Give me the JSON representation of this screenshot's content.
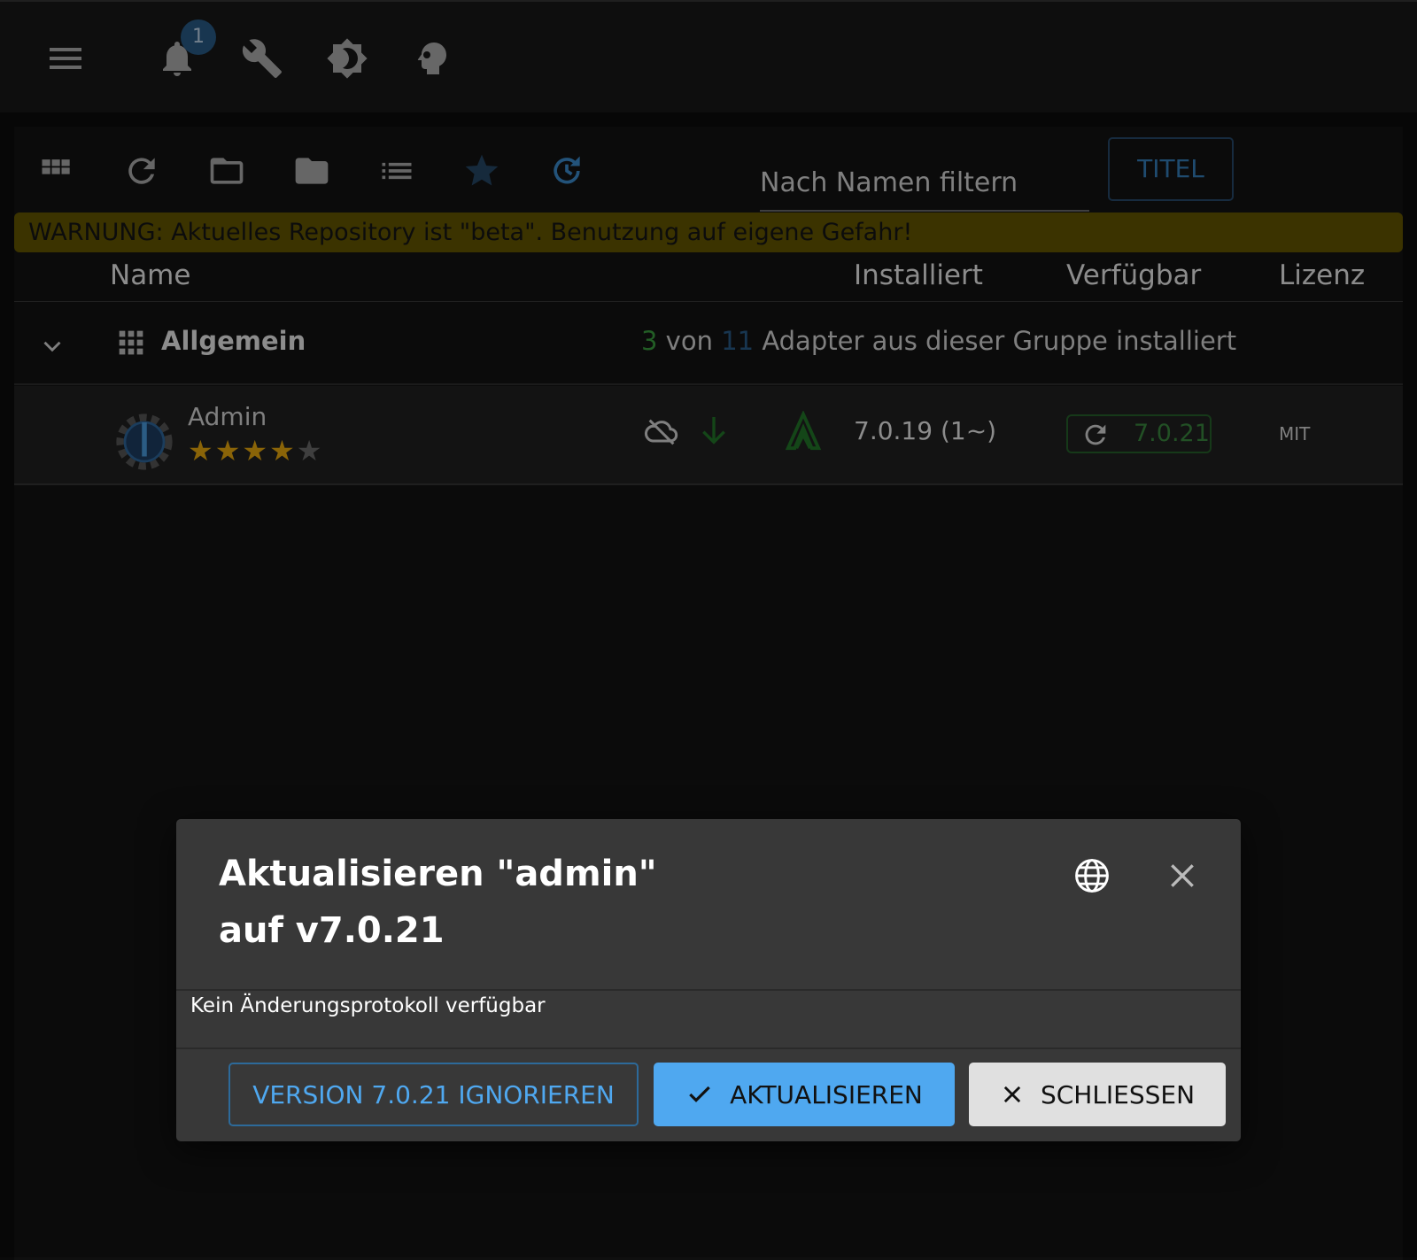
{
  "topbar": {
    "notification_count": "1"
  },
  "toolbar": {
    "filter_placeholder": "Nach Namen filtern",
    "title_button": "TITEL"
  },
  "warning": "WARNUNG: Aktuelles Repository ist \"beta\". Benutzung auf eigene Gefahr!",
  "table": {
    "headers": {
      "name": "Name",
      "installed": "Installiert",
      "available": "Verfügbar",
      "license": "Lizenz"
    }
  },
  "group": {
    "name": "Allgemein",
    "installed_count": "3",
    "von": "von",
    "total_count": "11",
    "suffix": "Adapter aus dieser Gruppe installiert"
  },
  "adapter": {
    "name": "Admin",
    "rating": 4.5,
    "installed": "7.0.19 (1~)",
    "available": "7.0.21",
    "license": "MIT"
  },
  "dialog": {
    "title": "Aktualisieren \"admin\" auf v7.0.21",
    "body": "Kein Änderungsprotokoll verfügbar",
    "ignore": "VERSION 7.0.21 IGNORIEREN",
    "update": "AKTUALISIEREN",
    "close": "SCHLIESSEN"
  },
  "colors": {
    "accent": "#4fa8f0",
    "green": "#2e7d32",
    "warning_bg": "#4f4500",
    "star": "#b8860b"
  }
}
